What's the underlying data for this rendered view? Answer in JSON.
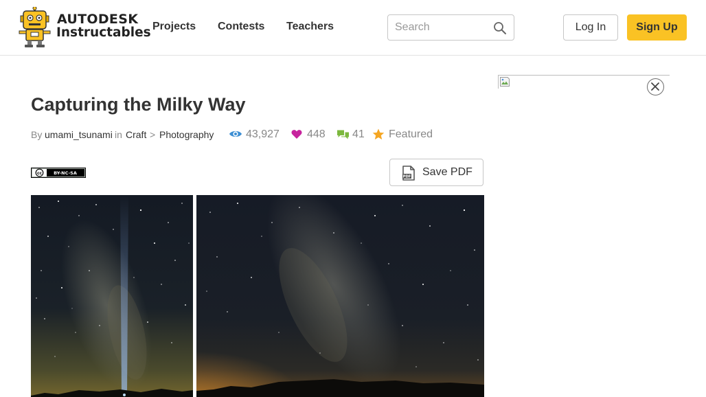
{
  "header": {
    "logo": {
      "brand_top": "AUTODESK",
      "brand_bottom": "Instructables",
      "robot_icon": "instructables-robot-icon"
    },
    "nav": [
      {
        "label": "Projects"
      },
      {
        "label": "Contests"
      },
      {
        "label": "Teachers"
      }
    ],
    "search": {
      "placeholder": "Search",
      "value": "",
      "icon": "search-icon"
    },
    "login_label": "Log In",
    "signup_label": "Sign Up"
  },
  "article": {
    "title": "Capturing the Milky Way",
    "by_label": "By",
    "author": "umami_tsunami",
    "in_label": "in",
    "category": "Craft",
    "separator": ">",
    "subcategory": "Photography",
    "views": "43,927",
    "favorites": "448",
    "comments": "41",
    "featured_label": "Featured",
    "license_badge": "BY-NC-SA",
    "save_pdf_label": "Save PDF",
    "pdf_icon_text": "PDF"
  },
  "colors": {
    "accent_yellow": "#fac224",
    "view_icon": "#3c8ed3",
    "heart_icon": "#c7249e",
    "comment_icon": "#7cb83e",
    "star_icon": "#f5a623",
    "text": "#333333",
    "muted": "#888888"
  },
  "icons": [
    "search-icon",
    "eye-icon",
    "heart-icon",
    "comment-icon",
    "star-icon",
    "pdf-icon",
    "close-icon",
    "cc-license-icon",
    "broken-image-icon"
  ]
}
